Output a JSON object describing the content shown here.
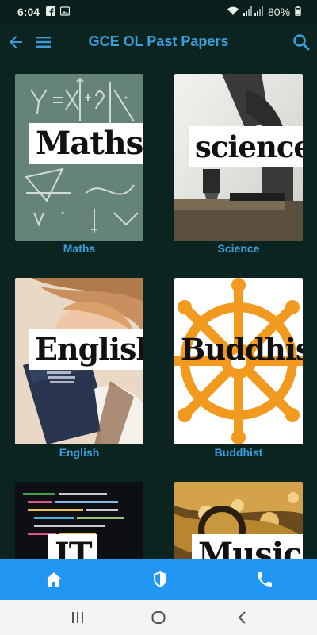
{
  "status_bar": {
    "time": "6:04",
    "battery": "80%",
    "icons": [
      "facebook-icon",
      "image-icon",
      "wifi-icon",
      "signal-icon",
      "signal-icon",
      "battery-icon"
    ]
  },
  "app_bar": {
    "title": "GCE OL Past Papers",
    "left_icons": [
      "back-arrow-icon",
      "menu-icon"
    ],
    "right_icon": "search-icon",
    "accent_color": "#3a9ede"
  },
  "subjects": [
    {
      "overlay": "Maths",
      "caption": "Maths"
    },
    {
      "overlay": "science",
      "caption": "Science"
    },
    {
      "overlay": "English",
      "caption": "English"
    },
    {
      "overlay": "Buddhist",
      "caption": "Buddhist"
    },
    {
      "overlay": "IT",
      "caption": ""
    },
    {
      "overlay": "Music",
      "caption": ""
    }
  ],
  "bottom_nav": {
    "items": [
      "home-icon",
      "shield-icon",
      "phone-icon"
    ],
    "background": "#2196f3"
  },
  "system_nav": {
    "items": [
      "recents-icon",
      "home-circle-icon",
      "back-chevron-icon"
    ]
  },
  "colors": {
    "background": "#0c2420",
    "caption": "#3a9ede"
  }
}
